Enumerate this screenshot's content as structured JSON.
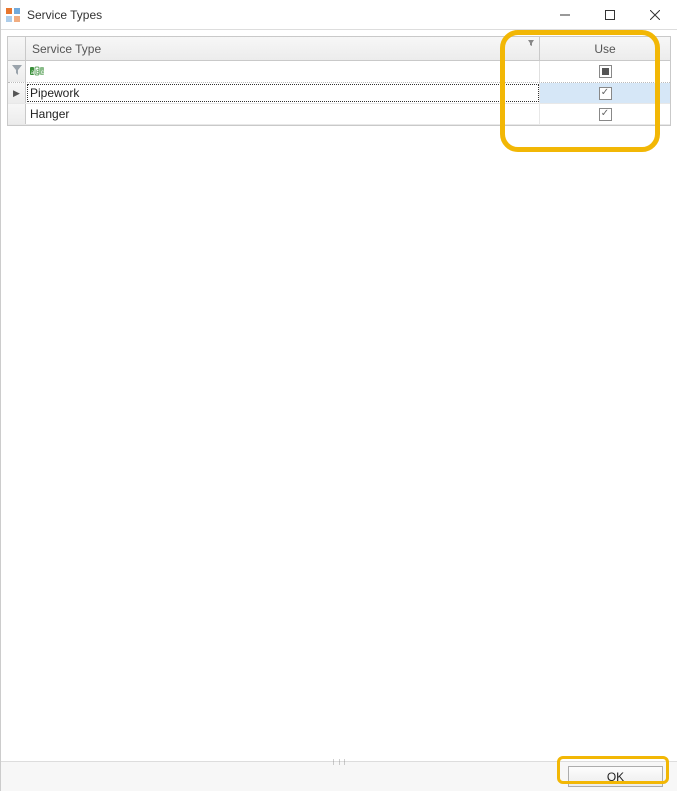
{
  "window": {
    "title": "Service Types"
  },
  "grid": {
    "columns": {
      "service_type": "Service Type",
      "use": "Use"
    },
    "filter_row": {
      "header_checkbox_state": "indeterminate"
    },
    "rows": [
      {
        "service_type": "Pipework",
        "use_checked": true,
        "selected": true
      },
      {
        "service_type": "Hanger",
        "use_checked": true,
        "selected": false
      }
    ]
  },
  "footer": {
    "ok_label": "OK"
  }
}
